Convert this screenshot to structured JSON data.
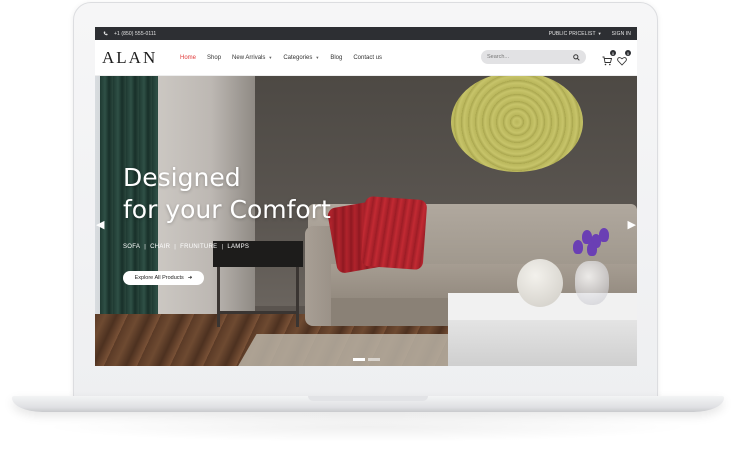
{
  "topbar": {
    "phone": "+1 (850) 555-0111",
    "pricelist": "PUBLIC PRICELIST",
    "signin": "SIGN IN"
  },
  "brand": {
    "logo": "ALAN"
  },
  "nav": {
    "items": [
      {
        "label": "Home",
        "active": true
      },
      {
        "label": "Shop"
      },
      {
        "label": "New Arrivals",
        "dropdown": true
      },
      {
        "label": "Categories",
        "dropdown": true
      },
      {
        "label": "Blog"
      },
      {
        "label": "Contact us"
      }
    ]
  },
  "search": {
    "placeholder": "Search..."
  },
  "cart": {
    "count": "0"
  },
  "wishlist": {
    "count": "0"
  },
  "hero": {
    "heading_line1": "Designed",
    "heading_line2": "for your Comfort",
    "categories": [
      "SOFA",
      "CHAIR",
      "FRUNITURE",
      "LAMPS"
    ],
    "cta_label": "Explore All Products",
    "slides_total": 2,
    "slide_active": 1
  },
  "colors": {
    "accent": "#e03a3a",
    "topbar_bg": "#2d2f33"
  }
}
